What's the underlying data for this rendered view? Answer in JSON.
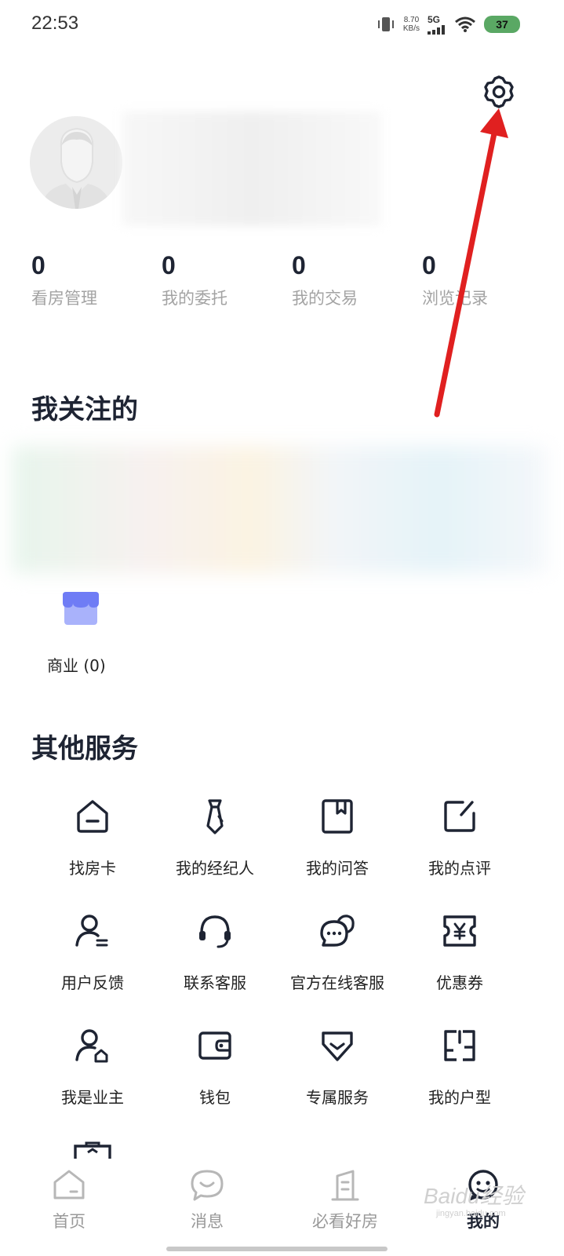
{
  "status_bar": {
    "time": "22:53",
    "net_speed_value": "8.70",
    "net_speed_unit": "KB/s",
    "network": "5G",
    "battery": "37"
  },
  "stats": [
    {
      "value": "0",
      "label": "看房管理"
    },
    {
      "value": "0",
      "label": "我的委托"
    },
    {
      "value": "0",
      "label": "我的交易"
    },
    {
      "value": "0",
      "label": "浏览记录"
    }
  ],
  "following": {
    "title": "我关注的",
    "commercial_label": "商业 (0)"
  },
  "services": {
    "title": "其他服务",
    "items": [
      {
        "label": "找房卡",
        "icon": "house-card-icon"
      },
      {
        "label": "我的经纪人",
        "icon": "tie-icon"
      },
      {
        "label": "我的问答",
        "icon": "bookmark-book-icon"
      },
      {
        "label": "我的点评",
        "icon": "edit-icon"
      },
      {
        "label": "用户反馈",
        "icon": "user-feedback-icon"
      },
      {
        "label": "联系客服",
        "icon": "headset-icon"
      },
      {
        "label": "官方在线客服",
        "icon": "chat-bubbles-icon"
      },
      {
        "label": "优惠券",
        "icon": "coupon-yen-icon"
      },
      {
        "label": "我是业主",
        "icon": "owner-icon"
      },
      {
        "label": "钱包",
        "icon": "wallet-icon"
      },
      {
        "label": "专属服务",
        "icon": "exclusive-service-icon"
      },
      {
        "label": "我的户型",
        "icon": "floorplan-icon"
      }
    ]
  },
  "bottom_nav": [
    {
      "label": "首页",
      "icon": "home-icon",
      "active": false
    },
    {
      "label": "消息",
      "icon": "message-icon",
      "active": false
    },
    {
      "label": "必看好房",
      "icon": "building-icon",
      "active": false
    },
    {
      "label": "我的",
      "icon": "profile-face-icon",
      "active": true
    }
  ],
  "watermark": {
    "text": "Baidu经验",
    "sub": "jingyan.baidu.com"
  },
  "colors": {
    "primary_text": "#1e2433",
    "muted_text": "#a3a3a3",
    "annotation_arrow": "#e02020",
    "store_icon": "#6f7cf5"
  }
}
